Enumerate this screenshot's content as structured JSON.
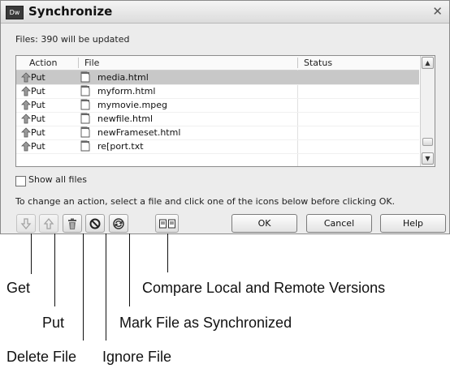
{
  "window": {
    "app_icon": "Dw",
    "title": "Synchronize",
    "close_icon": "close-icon"
  },
  "summary": "Files: 390 will be updated",
  "list": {
    "columns": [
      "Action",
      "File",
      "Status"
    ],
    "rows": [
      {
        "action": "Put",
        "file": "media.html",
        "status": "",
        "selected": true
      },
      {
        "action": "Put",
        "file": "myform.html",
        "status": ""
      },
      {
        "action": "Put",
        "file": "mymovie.mpeg",
        "status": ""
      },
      {
        "action": "Put",
        "file": "newfile.html",
        "status": ""
      },
      {
        "action": "Put",
        "file": "newFrameset.html",
        "status": ""
      },
      {
        "action": "Put",
        "file": "re[port.txt",
        "status": ""
      }
    ]
  },
  "show_all_files": {
    "label": "Show all files",
    "checked": false
  },
  "hint": "To change an action, select a file and click one of the icons below before clicking OK.",
  "toolbar_icons": [
    "get-icon",
    "put-icon",
    "delete-icon",
    "ignore-icon",
    "synchronized-icon",
    "compare-icon"
  ],
  "buttons": {
    "ok": "OK",
    "cancel": "Cancel",
    "help": "Help"
  },
  "callouts": {
    "get": "Get",
    "put": "Put",
    "delete": "Delete File",
    "ignore": "Ignore File",
    "synchronized": "Mark File as Synchronized",
    "compare": "Compare Local and Remote Versions"
  }
}
